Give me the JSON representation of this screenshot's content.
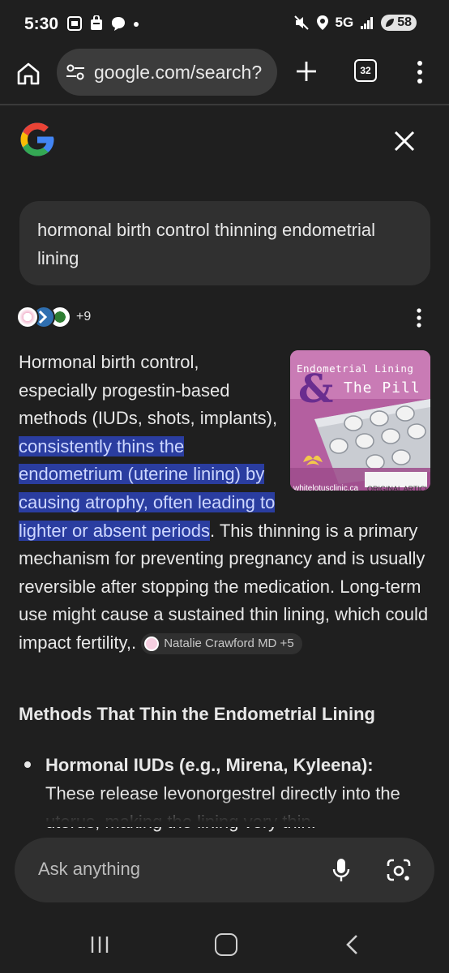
{
  "status_bar": {
    "time": "5:30",
    "network": "5G",
    "battery": "58"
  },
  "browser": {
    "url": "google.com/search?",
    "tab_count": "32"
  },
  "search": {
    "query": "hormonal birth control thinning endometrial lining"
  },
  "sources": {
    "extra_count": "+9"
  },
  "answer": {
    "intro": "Hormonal birth control, especially progestin-based methods (IUDs, shots, implants), ",
    "highlight": "consistently thins the endometrium (uterine lining) by causing atrophy, often leading to lighter or absent periods",
    "rest": ". This thinning is a primary mechanism for preventing pregnancy and is usually reversible after stopping the medication. Long-term use might cause a sustained thin lining, which could impact fertility,.",
    "citation": "Natalie Crawford MD +5",
    "thumbnail": {
      "line1": "Endometrial Lining",
      "amp": "&",
      "line2": "The Pill",
      "site": "whitelotusclinic.ca",
      "badge": "ORIGINAL ARTICLE"
    }
  },
  "methods": {
    "heading": "Methods That Thin the Endometrial Lining",
    "items": [
      {
        "title": "Hormonal IUDs (e.g., Mirena, Kyleena):",
        "text": " These release levonorgestrel directly into the uterus, making the lining very thin."
      }
    ]
  },
  "ask": {
    "placeholder": "Ask anything"
  },
  "colors": {
    "background": "#1f1f1f",
    "highlight_bg": "#2a3da0",
    "highlight_text": "#cdd7ff",
    "thumbnail_pink": "#b45fa0"
  }
}
